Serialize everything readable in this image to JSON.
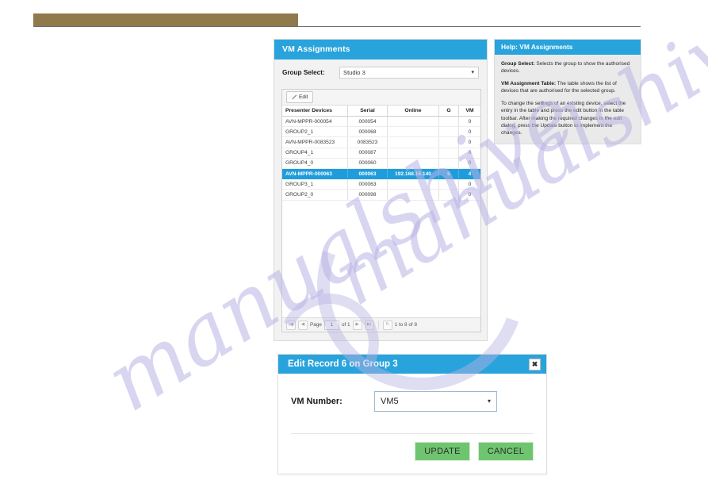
{
  "header": {
    "banner_color": "#907a4b"
  },
  "vm_card": {
    "title": "VM Assignments",
    "group_select_label": "Group Select:",
    "group_select_value": "Studio 3",
    "toolbar": {
      "edit_label": "Edit",
      "edit_icon": "pencil-icon"
    },
    "table": {
      "columns": [
        "Presenter Devices",
        "Serial",
        "Online",
        "G",
        "VM"
      ],
      "rows": [
        {
          "device": "AVN-MPPR-000054",
          "serial": "000054",
          "online": "",
          "g": "",
          "vm": "0",
          "selected": false
        },
        {
          "device": "GROUP2_1",
          "serial": "000068",
          "online": "",
          "g": "",
          "vm": "0",
          "selected": false
        },
        {
          "device": "AVN-MPPR-0083523",
          "serial": "0083523",
          "online": "",
          "g": "",
          "vm": "0",
          "selected": false
        },
        {
          "device": "GROUP4_1",
          "serial": "000087",
          "online": "",
          "g": "",
          "vm": "0",
          "selected": false
        },
        {
          "device": "GROUP4_0",
          "serial": "000060",
          "online": "",
          "g": "",
          "vm": "0",
          "selected": false
        },
        {
          "device": "AVN-MPPR-000063",
          "serial": "000063",
          "online": "192.168.15.140",
          "g": "5",
          "vm": "4",
          "selected": true
        },
        {
          "device": "GROUP3_1",
          "serial": "000063",
          "online": "",
          "g": "",
          "vm": "0",
          "selected": false
        },
        {
          "device": "GROUP2_0",
          "serial": "000098",
          "online": "",
          "g": "",
          "vm": "0",
          "selected": false
        }
      ]
    },
    "pagination": {
      "first_icon": "first-page-icon",
      "prev_icon": "prev-page-icon",
      "page_label": "Page",
      "page_value": "1",
      "of_label": "of 1",
      "next_icon": "next-page-icon",
      "last_icon": "last-page-icon",
      "refresh_icon": "refresh-icon",
      "range_text": "1 to 8 of 8"
    }
  },
  "help_card": {
    "title": "Help: VM Assignments",
    "paragraphs": [
      {
        "term": "Group Select:",
        "text": " Selects the group to show the authorised devices."
      },
      {
        "term": "VM Assignment Table:",
        "text": " The table shows the list of devices that are authorised for the selected group."
      },
      {
        "term": "",
        "text": "To change the settings of an existing device, select the entry in the table and press the edit button in the table toolbar. After making the required changes in the edit dialog, press the Update button to implement the changes."
      }
    ]
  },
  "edit_dialog": {
    "title": "Edit Record 6 on Group 3",
    "close_icon": "close-icon",
    "field_label": "VM Number:",
    "field_value": "VM5",
    "update_label": "UPDATE",
    "cancel_label": "CANCEL"
  },
  "watermark": {
    "text_1": "manualshive",
    "text_2": "manualshive"
  }
}
